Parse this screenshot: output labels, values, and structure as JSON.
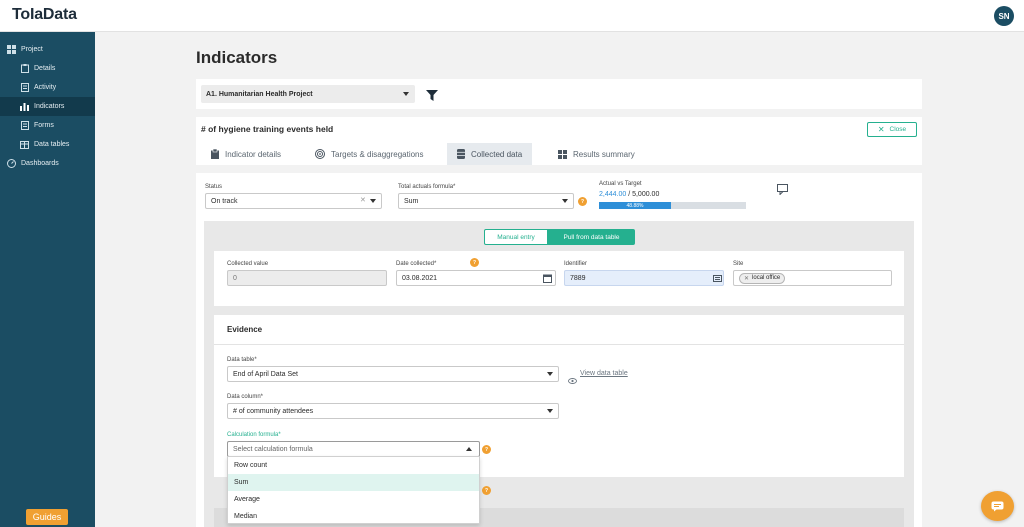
{
  "app": {
    "logo": "ToIaData",
    "user_initials": "SN"
  },
  "sidebar": {
    "items": [
      {
        "label": "Project",
        "icon": "grid-icon"
      },
      {
        "label": "Details",
        "icon": "clipboard-icon"
      },
      {
        "label": "Activity",
        "icon": "activity-icon"
      },
      {
        "label": "Indicators",
        "icon": "bar-chart-icon"
      },
      {
        "label": "Forms",
        "icon": "form-icon"
      },
      {
        "label": "Data tables",
        "icon": "table-icon"
      },
      {
        "label": "Dashboards",
        "icon": "dashboard-icon"
      }
    ],
    "guides_label": "Guides"
  },
  "page": {
    "title": "Indicators"
  },
  "project_select": {
    "value": "A1. Humanitarian Health Project"
  },
  "indicator": {
    "title": "# of hygiene training events held",
    "close_label": "Close"
  },
  "tabs": [
    {
      "label": "Indicator details"
    },
    {
      "label": "Targets & disaggregations"
    },
    {
      "label": "Collected data"
    },
    {
      "label": "Results summary"
    }
  ],
  "status": {
    "label": "Status",
    "value": "On track"
  },
  "total_formula": {
    "label": "Total actuals formula*",
    "value": "Sum"
  },
  "actual_vs_target": {
    "label": "Actual vs Target",
    "actual": "2,444.00",
    "separator": " / ",
    "target": "5,000.00",
    "percent_text": "48.88%",
    "percent": 48.88
  },
  "entry_toggle": {
    "manual": "Manual entry",
    "pull": "Pull from data table"
  },
  "collected_value": {
    "label": "Collected value",
    "value": "0"
  },
  "date_collected": {
    "label": "Date collected*",
    "value": "03.08.2021"
  },
  "identifier": {
    "label": "Identifier",
    "value": "7889"
  },
  "site": {
    "label": "Site",
    "tag": "local office"
  },
  "evidence": {
    "title": "Evidence"
  },
  "data_table": {
    "label": "Data table*",
    "value": "End of April Data Set",
    "view_link": "View data table"
  },
  "data_column": {
    "label": "Data column*",
    "value": "# of community attendees"
  },
  "calc_formula": {
    "label": "Calculation formula*",
    "placeholder": "Select calculation formula",
    "options": [
      "Row count",
      "Sum",
      "Average",
      "Median"
    ]
  },
  "colors": {
    "sidebar": "#1b4d63",
    "accent": "#25b08f",
    "warning": "#f0a032",
    "progress": "#2e8fd8"
  }
}
